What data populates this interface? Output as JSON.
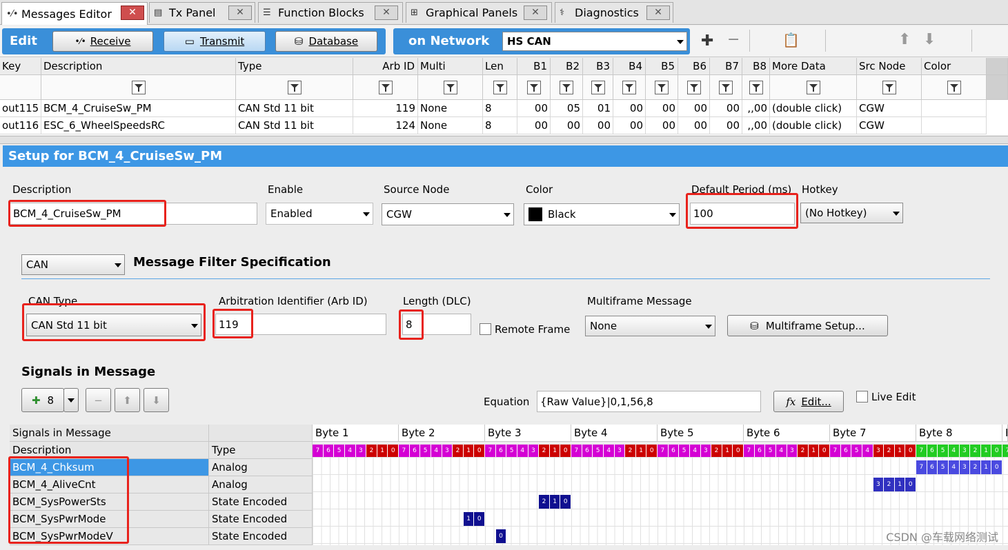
{
  "tabs": [
    {
      "label": "Messages Editor",
      "icon": "messages-icon",
      "active": true
    },
    {
      "label": "Tx Panel",
      "icon": "tx-panel-icon"
    },
    {
      "label": "Function Blocks",
      "icon": "function-blocks-icon"
    },
    {
      "label": "Graphical Panels",
      "icon": "graphical-panels-icon"
    },
    {
      "label": "Diagnostics",
      "icon": "diagnostics-icon"
    }
  ],
  "toolbar": {
    "edit_label": "Edit",
    "receive_label": "Receive",
    "transmit_label": "Transmit",
    "database_label": "Database",
    "network_label": "on Network",
    "network_value": "HS CAN"
  },
  "grid": {
    "columns": [
      "Key",
      "Description",
      "Type",
      "Arb ID",
      "Multi",
      "Len",
      "B1",
      "B2",
      "B3",
      "B4",
      "B5",
      "B6",
      "B7",
      "B8",
      "More Data",
      "Src Node",
      "Color"
    ],
    "rows": [
      [
        "out115",
        "BCM_4_CruiseSw_PM",
        "CAN Std 11 bit",
        "119",
        "None",
        "8",
        "00",
        "05",
        "01",
        "00",
        "00",
        "00",
        "00",
        ",,00",
        "(double click)",
        "CGW",
        ""
      ],
      [
        "out116",
        "ESC_6_WheelSpeedsRC",
        "CAN Std 11 bit",
        "124",
        "None",
        "8",
        "00",
        "00",
        "00",
        "00",
        "00",
        "00",
        "00",
        ",,00",
        "(double click)",
        "CGW",
        ""
      ]
    ]
  },
  "setup": {
    "title": "Setup for BCM_4_CruiseSw_PM",
    "description_label": "Description",
    "description_value": "BCM_4_CruiseSw_PM",
    "enable_label": "Enable",
    "enable_value": "Enabled",
    "source_node_label": "Source Node",
    "source_node_value": "CGW",
    "color_label": "Color",
    "color_value": "Black",
    "period_label": "Default Period (ms)",
    "period_value": "100",
    "hotkey_label": "Hotkey",
    "hotkey_value": "(No Hotkey)",
    "protocol_value": "CAN",
    "filter_spec_label": "Message Filter Specification",
    "can_type_label": "CAN Type",
    "can_type_value": "CAN Std 11 bit",
    "arb_id_label": "Arbitration Identifier (Arb ID)",
    "arb_id_value": "119",
    "length_label": "Length (DLC)",
    "length_value": "8",
    "remote_frame_label": "Remote Frame",
    "multiframe_label": "Multiframe Message",
    "multiframe_value": "None",
    "multiframe_setup_label": "Multiframe Setup...",
    "signals_title": "Signals in Message",
    "add_count": "8",
    "equation_label": "Equation",
    "equation_value": "{Raw Value}|0,1,56,8",
    "edit_label": "Edit...",
    "live_edit_label": "Live Edit"
  },
  "signals": {
    "header_top": "Signals in Message",
    "col_description": "Description",
    "col_type": "Type",
    "bytes": [
      "Byte 1",
      "Byte 2",
      "Byte 3",
      "Byte 4",
      "Byte 5",
      "Byte 6",
      "Byte 7",
      "Byte 8",
      "B"
    ],
    "rows": [
      {
        "description": "BCM_4_Chksum",
        "type": "Analog",
        "selected": true
      },
      {
        "description": "BCM_4_AliveCnt",
        "type": "Analog"
      },
      {
        "description": "BCM_SysPowerSts",
        "type": "State Encoded"
      },
      {
        "description": "BCM_SysPwrMode",
        "type": "State Encoded"
      },
      {
        "description": "BCM_SysPwrModeV",
        "type": "State Encoded"
      }
    ]
  },
  "colors": {
    "accent": "#3d97e5",
    "highlight": "#e8221c",
    "bit_magenta": "#d400d4",
    "bit_red": "#cc0000",
    "bit_green": "#22cc22",
    "signal_blue": "#2020a0"
  },
  "watermark": "CSDN @车载网络测试"
}
